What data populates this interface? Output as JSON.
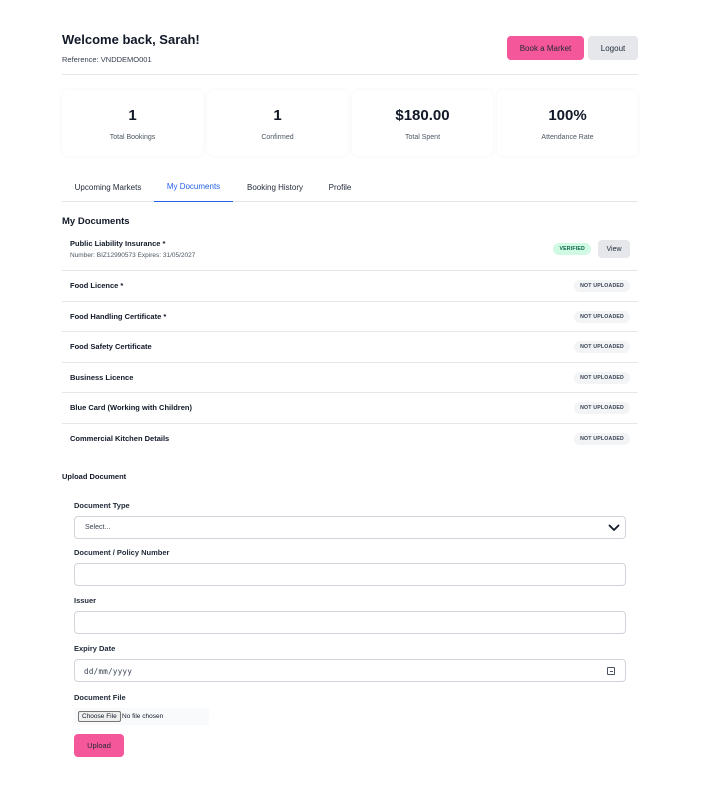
{
  "header": {
    "welcome": "Welcome back, Sarah!",
    "reference": "Reference: VNDDEMO001",
    "book_label": "Book a Market",
    "logout_label": "Logout"
  },
  "stats": [
    {
      "value": "1",
      "label": "Total Bookings"
    },
    {
      "value": "1",
      "label": "Confirmed"
    },
    {
      "value": "$180.00",
      "label": "Total Spent"
    },
    {
      "value": "100%",
      "label": "Attendance Rate"
    }
  ],
  "tabs": [
    {
      "label": "Upcoming Markets"
    },
    {
      "label": "My Documents"
    },
    {
      "label": "Booking History"
    },
    {
      "label": "Profile"
    }
  ],
  "active_tab": "My Documents",
  "documents": {
    "title": "My Documents",
    "items": [
      {
        "name": "Public Liability Insurance *",
        "meta": "Number: BIZ12990573 Expires: 31/05/2027",
        "status": "VERIFIED",
        "action": "View"
      },
      {
        "name": "Food Licence *",
        "status": "NOT UPLOADED"
      },
      {
        "name": "Food Handling Certificate *",
        "status": "NOT UPLOADED"
      },
      {
        "name": "Food Safety Certificate",
        "status": "NOT UPLOADED"
      },
      {
        "name": "Business Licence",
        "status": "NOT UPLOADED"
      },
      {
        "name": "Blue Card (Working with Children)",
        "status": "NOT UPLOADED"
      },
      {
        "name": "Commercial Kitchen Details",
        "status": "NOT UPLOADED"
      }
    ]
  },
  "upload": {
    "title": "Upload Document",
    "document_type_label": "Document Type",
    "document_type_value": "Select...",
    "policy_number_label": "Document / Policy Number",
    "issuer_label": "Issuer",
    "expiry_label": "Expiry Date",
    "expiry_placeholder": "dd/mm/yyyy",
    "file_label": "Document File",
    "choose_file_label": "Choose File",
    "no_file_text": "No file chosen",
    "upload_label": "Upload"
  },
  "colors": {
    "accent_pink": "#f4579a",
    "active_tab_blue": "#2563eb",
    "verified_bg": "#d1fae5"
  }
}
